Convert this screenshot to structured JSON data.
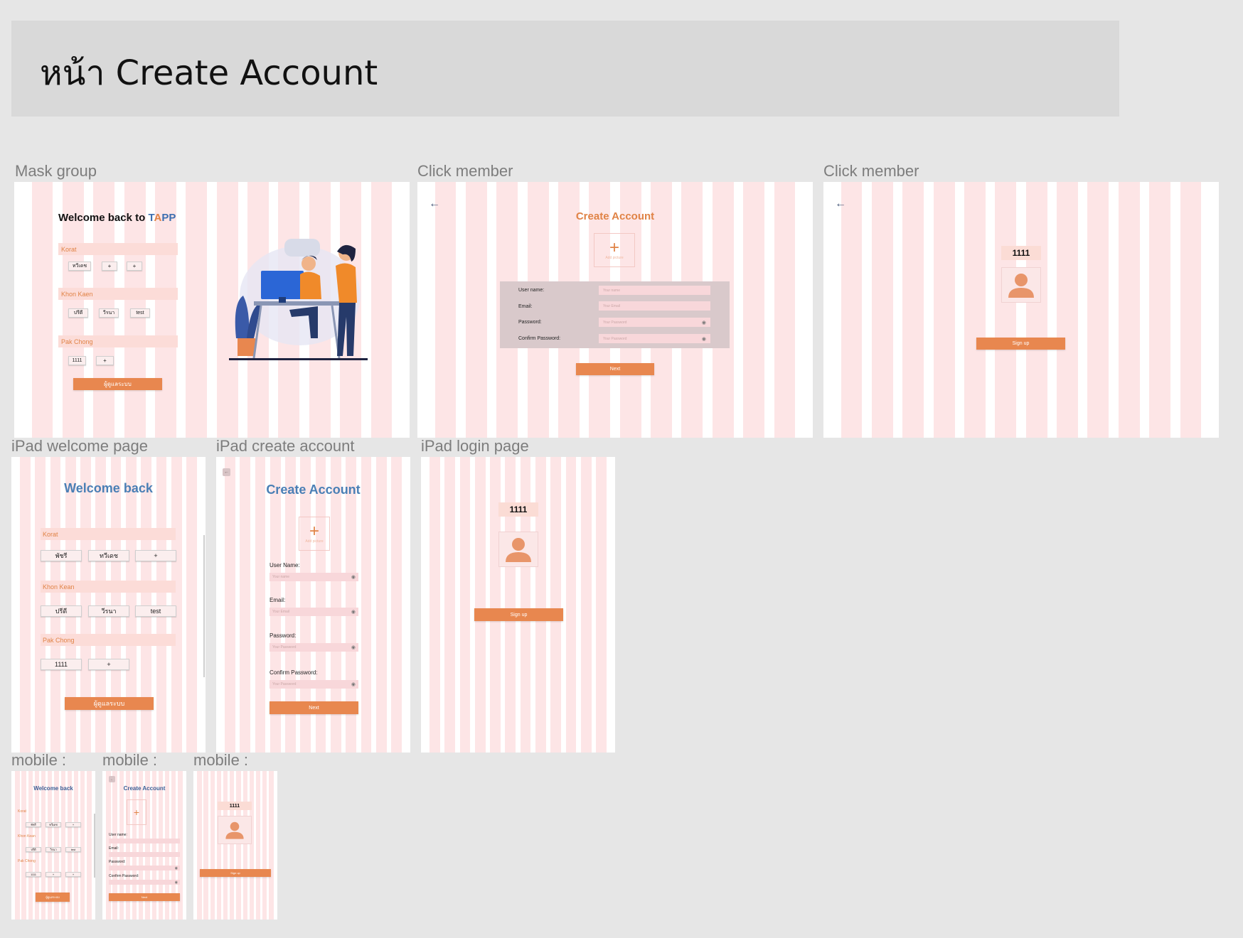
{
  "header": {
    "title": "หน้า Create Account"
  },
  "frames": {
    "f1_label": "Mask group",
    "f2_label": "Click member",
    "f3_label": "Click member",
    "f4_label": "iPad welcome page",
    "f5_label": "iPad create account",
    "f6_label": "iPad login page",
    "f7_label": "mobile :",
    "f8_label": "mobile :",
    "f9_label": "mobile :"
  },
  "welcome": {
    "title_prefix": "Welcome back to ",
    "title_brand_t": "T",
    "title_brand_a": "A",
    "title_brand_pp": "PP",
    "title_short": "Welcome back",
    "section_korat": "Korat",
    "section_khonkaen": "Khon Kaen",
    "section_khonkean": "Khon Kean",
    "section_pakchong": "Pak Chong",
    "korat_chips_desktop": [
      "ทวีเดช",
      "+",
      "+"
    ],
    "korat_chips_ipad": [
      "พัชรี",
      "ทวีเดช",
      "+"
    ],
    "khonkaen_chips": [
      "ปรีดี",
      "วีรนา",
      "test"
    ],
    "pakchong_chips": [
      "1111",
      "+"
    ],
    "pakchong_chips_mobile": [
      "1111",
      "+",
      "+"
    ],
    "admin_button": "ผู้ดูแลระบบ"
  },
  "create": {
    "title": "Create Account",
    "add_picture": "Add picture",
    "username_label": "User name:",
    "username_label_ipad": "User Name:",
    "email_label": "Email:",
    "password_label": "Password:",
    "confirm_label": "Confirm Password:",
    "username_ph": "Your name",
    "email_ph": "Your Email",
    "password_ph": "Your Password",
    "confirm_ph": "Your Password",
    "next_button": "Next",
    "back_arrow": "←"
  },
  "login": {
    "user_id": "1111",
    "signup_button": "Sign up",
    "back_arrow": "←"
  },
  "colors": {
    "accent": "#e8874f",
    "blue": "#4a7fb5",
    "stripe": "#fde5e6"
  }
}
